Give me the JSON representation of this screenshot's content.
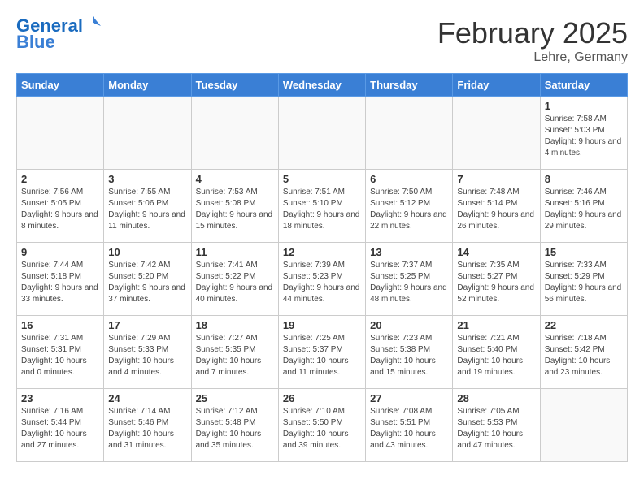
{
  "header": {
    "logo_line1": "General",
    "logo_line2": "Blue",
    "month": "February 2025",
    "location": "Lehre, Germany"
  },
  "weekdays": [
    "Sunday",
    "Monday",
    "Tuesday",
    "Wednesday",
    "Thursday",
    "Friday",
    "Saturday"
  ],
  "weeks": [
    [
      {
        "day": "",
        "info": ""
      },
      {
        "day": "",
        "info": ""
      },
      {
        "day": "",
        "info": ""
      },
      {
        "day": "",
        "info": ""
      },
      {
        "day": "",
        "info": ""
      },
      {
        "day": "",
        "info": ""
      },
      {
        "day": "1",
        "info": "Sunrise: 7:58 AM\nSunset: 5:03 PM\nDaylight: 9 hours and 4 minutes."
      }
    ],
    [
      {
        "day": "2",
        "info": "Sunrise: 7:56 AM\nSunset: 5:05 PM\nDaylight: 9 hours and 8 minutes."
      },
      {
        "day": "3",
        "info": "Sunrise: 7:55 AM\nSunset: 5:06 PM\nDaylight: 9 hours and 11 minutes."
      },
      {
        "day": "4",
        "info": "Sunrise: 7:53 AM\nSunset: 5:08 PM\nDaylight: 9 hours and 15 minutes."
      },
      {
        "day": "5",
        "info": "Sunrise: 7:51 AM\nSunset: 5:10 PM\nDaylight: 9 hours and 18 minutes."
      },
      {
        "day": "6",
        "info": "Sunrise: 7:50 AM\nSunset: 5:12 PM\nDaylight: 9 hours and 22 minutes."
      },
      {
        "day": "7",
        "info": "Sunrise: 7:48 AM\nSunset: 5:14 PM\nDaylight: 9 hours and 26 minutes."
      },
      {
        "day": "8",
        "info": "Sunrise: 7:46 AM\nSunset: 5:16 PM\nDaylight: 9 hours and 29 minutes."
      }
    ],
    [
      {
        "day": "9",
        "info": "Sunrise: 7:44 AM\nSunset: 5:18 PM\nDaylight: 9 hours and 33 minutes."
      },
      {
        "day": "10",
        "info": "Sunrise: 7:42 AM\nSunset: 5:20 PM\nDaylight: 9 hours and 37 minutes."
      },
      {
        "day": "11",
        "info": "Sunrise: 7:41 AM\nSunset: 5:22 PM\nDaylight: 9 hours and 40 minutes."
      },
      {
        "day": "12",
        "info": "Sunrise: 7:39 AM\nSunset: 5:23 PM\nDaylight: 9 hours and 44 minutes."
      },
      {
        "day": "13",
        "info": "Sunrise: 7:37 AM\nSunset: 5:25 PM\nDaylight: 9 hours and 48 minutes."
      },
      {
        "day": "14",
        "info": "Sunrise: 7:35 AM\nSunset: 5:27 PM\nDaylight: 9 hours and 52 minutes."
      },
      {
        "day": "15",
        "info": "Sunrise: 7:33 AM\nSunset: 5:29 PM\nDaylight: 9 hours and 56 minutes."
      }
    ],
    [
      {
        "day": "16",
        "info": "Sunrise: 7:31 AM\nSunset: 5:31 PM\nDaylight: 10 hours and 0 minutes."
      },
      {
        "day": "17",
        "info": "Sunrise: 7:29 AM\nSunset: 5:33 PM\nDaylight: 10 hours and 4 minutes."
      },
      {
        "day": "18",
        "info": "Sunrise: 7:27 AM\nSunset: 5:35 PM\nDaylight: 10 hours and 7 minutes."
      },
      {
        "day": "19",
        "info": "Sunrise: 7:25 AM\nSunset: 5:37 PM\nDaylight: 10 hours and 11 minutes."
      },
      {
        "day": "20",
        "info": "Sunrise: 7:23 AM\nSunset: 5:38 PM\nDaylight: 10 hours and 15 minutes."
      },
      {
        "day": "21",
        "info": "Sunrise: 7:21 AM\nSunset: 5:40 PM\nDaylight: 10 hours and 19 minutes."
      },
      {
        "day": "22",
        "info": "Sunrise: 7:18 AM\nSunset: 5:42 PM\nDaylight: 10 hours and 23 minutes."
      }
    ],
    [
      {
        "day": "23",
        "info": "Sunrise: 7:16 AM\nSunset: 5:44 PM\nDaylight: 10 hours and 27 minutes."
      },
      {
        "day": "24",
        "info": "Sunrise: 7:14 AM\nSunset: 5:46 PM\nDaylight: 10 hours and 31 minutes."
      },
      {
        "day": "25",
        "info": "Sunrise: 7:12 AM\nSunset: 5:48 PM\nDaylight: 10 hours and 35 minutes."
      },
      {
        "day": "26",
        "info": "Sunrise: 7:10 AM\nSunset: 5:50 PM\nDaylight: 10 hours and 39 minutes."
      },
      {
        "day": "27",
        "info": "Sunrise: 7:08 AM\nSunset: 5:51 PM\nDaylight: 10 hours and 43 minutes."
      },
      {
        "day": "28",
        "info": "Sunrise: 7:05 AM\nSunset: 5:53 PM\nDaylight: 10 hours and 47 minutes."
      },
      {
        "day": "",
        "info": ""
      }
    ]
  ]
}
